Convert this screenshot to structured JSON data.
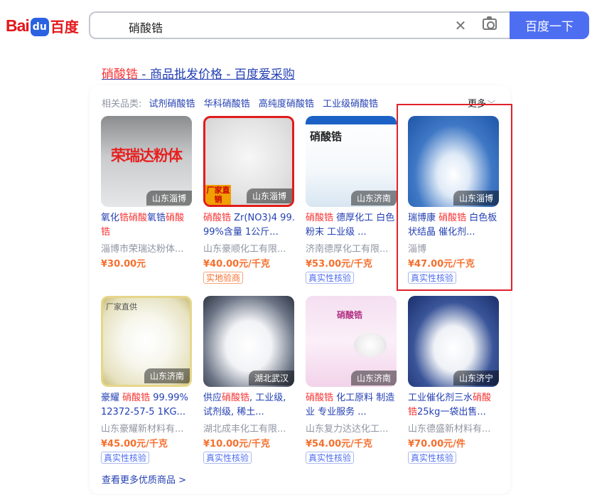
{
  "search": {
    "query": "硝酸锆",
    "button_label": "百度一下"
  },
  "logo": {
    "bai": "Bai",
    "du": "du",
    "cn": "百度"
  },
  "result": {
    "title_hl": "硝酸锆",
    "title_rest": " - 商品批发价格 - 百度爱采购"
  },
  "related": {
    "label": "相关品类:",
    "items": [
      "试剂硝酸锆",
      "华科硝酸锆",
      "高纯度硝酸锆",
      "工业级硝酸锆"
    ],
    "more_label": "更多"
  },
  "products": [
    {
      "location": "山东淄博",
      "image_text": "荣瑞达粉体",
      "title_parts": [
        {
          "t": "氧化",
          "hl": false
        },
        {
          "t": "锆",
          "hl": true
        },
        {
          "t": "硝酸",
          "hl": true
        },
        {
          "t": "氧锆",
          "hl": false
        },
        {
          "t": "硝酸",
          "hl": true
        },
        {
          "t": "锆",
          "hl": true
        }
      ],
      "seller": "淄博市荣瑞达粉体...",
      "price": "¥30.00元",
      "badge": "",
      "badge_style": "blue"
    },
    {
      "location": "山东淄博",
      "image_text": "厂家直销",
      "title_parts": [
        {
          "t": "硝酸锆",
          "hl": true
        },
        {
          "t": " Zr(NO3)4 99.99%含量 1公斤...",
          "hl": false
        }
      ],
      "seller": "山东豪顺化工有限...",
      "price": "¥40.00元/千克",
      "badge": "实地验商",
      "badge_style": "orange"
    },
    {
      "location": "山东济南",
      "image_text": "硝酸锆",
      "title_parts": [
        {
          "t": "硝酸锆",
          "hl": true
        },
        {
          "t": " 德厚化工 白色粉末 工业级 ...",
          "hl": false
        }
      ],
      "seller": "济南德厚化工有限...",
      "price": "¥53.00元/千克",
      "badge": "真实性核验",
      "badge_style": "blue"
    },
    {
      "location": "山东淄博",
      "image_text": "",
      "title_parts": [
        {
          "t": "瑞博康 ",
          "hl": false
        },
        {
          "t": "硝酸锆",
          "hl": true
        },
        {
          "t": " 白色板状结晶 催化剂...",
          "hl": false
        }
      ],
      "seller": "淄博",
      "price": "¥47.00元/千克",
      "badge": "真实性核验",
      "badge_style": "blue"
    },
    {
      "location": "山东济南",
      "image_text": "厂家直供",
      "title_parts": [
        {
          "t": "豪耀 ",
          "hl": false
        },
        {
          "t": "硝酸锆",
          "hl": true
        },
        {
          "t": " 99.99% 12372-57-5 1KG...",
          "hl": false
        }
      ],
      "seller": "山东豪耀新材料有...",
      "price": "¥45.00元/千克",
      "badge": "真实性核验",
      "badge_style": "blue"
    },
    {
      "location": "湖北武汉",
      "image_text": "",
      "title_parts": [
        {
          "t": "供应",
          "hl": false
        },
        {
          "t": "硝酸锆",
          "hl": true
        },
        {
          "t": ", 工业级, 试剂级, 稀土...",
          "hl": false
        }
      ],
      "seller": "湖北成丰化工有限...",
      "price": "¥10.00元/千克",
      "badge": "真实性核验",
      "badge_style": "blue"
    },
    {
      "location": "山东济南",
      "image_text": "硝酸锆",
      "title_parts": [
        {
          "t": "硝酸锆",
          "hl": true
        },
        {
          "t": " 化工原料 制造业 专业服务 ...",
          "hl": false
        }
      ],
      "seller": "山东复力达达化工...",
      "price": "¥54.00元/千克",
      "badge": "真实性核验",
      "badge_style": "blue"
    },
    {
      "location": "山东济宁",
      "image_text": "",
      "title_parts": [
        {
          "t": "工业催化剂三水",
          "hl": false
        },
        {
          "t": "硝酸锆",
          "hl": true
        },
        {
          "t": "25kg一袋出售...",
          "hl": false
        }
      ],
      "seller": "山东德盛新材料有...",
      "price": "¥70.00元/件",
      "badge": "真实性核验",
      "badge_style": "blue"
    }
  ],
  "view_more": "查看更多优质商品 >"
}
